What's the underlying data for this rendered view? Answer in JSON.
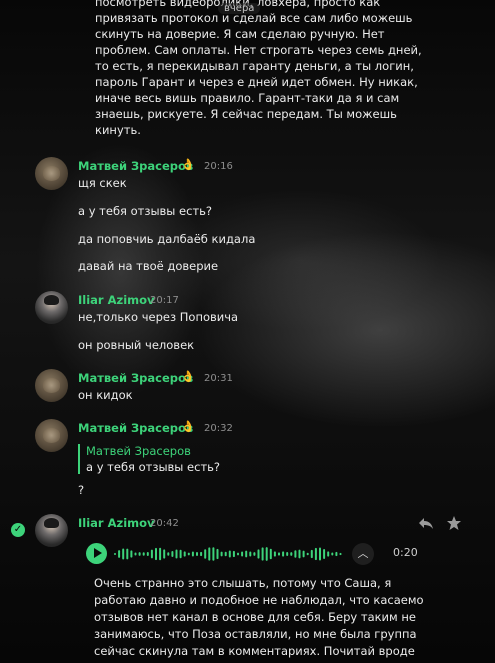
{
  "date_badge": "вчера",
  "top_message_lines": [
    "посмотреть видеоролики, ловхера, просто как",
    "привязать протокол и сделай все сам либо можешь",
    "скинуть на доверие. Я сам сделаю ручную. Нет",
    "проблем. Сам оплаты. Нет строгать через семь дней,",
    "то есть, я перекидывал гаранту деньги, а ты логин,",
    "пароль Гарант и через е дней идет обмен. Ну никак,",
    "иначе весь вишь правило. Гарант-таки да я и сам",
    "знаешь, рискуете. Я сейчас передам. Ты можешь",
    "кинуть."
  ],
  "messages": [
    {
      "author": "Матвей Зрасеров",
      "emoji": "👌",
      "time": "20:16",
      "lines": [
        "щя скек",
        "а у тебя отзывы есть?",
        "да поповчиь далбаёб кидала",
        "давай на твоё доверие"
      ]
    },
    {
      "author": "Iliar Azimov",
      "time": "20:17",
      "lines": [
        "не,только через Поповича",
        "он ровный человек"
      ]
    },
    {
      "author": "Матвей Зрасеров",
      "emoji": "👌",
      "time": "20:31",
      "lines": [
        "он кидок"
      ]
    },
    {
      "author": "Матвей Зрасеров",
      "emoji": "👌",
      "time": "20:32",
      "reply": {
        "author": "Матвей Зрасеров",
        "text": "а у тебя отзывы есть?"
      },
      "lines": [
        "?"
      ]
    },
    {
      "author": "Iliar Azimov",
      "time": "20:42",
      "voice": {
        "duration": "0:20"
      },
      "transcript_lines": [
        "Очень странно это слышать, потому что Саша, я",
        "работаю давно и подобное не наблюдал, что касаемо",
        "отзывов нет канал в основе для себя. Беру таким не",
        "занимаюсь, что Поза оставляли, но мне была группа",
        "сейчас скинула там в комментариях. Почитай вроде"
      ]
    }
  ],
  "icons": {
    "check": "check-circle-icon",
    "reply": "reply-icon",
    "star": "star-icon",
    "play": "play-icon",
    "collapse": "chevron-up-icon"
  },
  "colors": {
    "accent": "#3dd37a",
    "background": "#0b0b0b",
    "text": "#ececec",
    "time": "#8e8e8e"
  }
}
